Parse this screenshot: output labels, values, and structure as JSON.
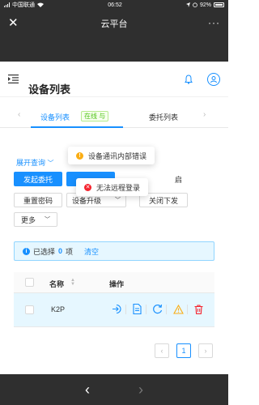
{
  "statusbar": {
    "carrier": "中国联通",
    "time": "06:52",
    "battery": "92%"
  },
  "titlebar": {
    "close_icon": "close-icon",
    "title": "云平台",
    "more": "···"
  },
  "topbar": {
    "menu_icon": "indent-menu-icon",
    "bell_icon": "bell-icon",
    "user_icon": "user-icon",
    "accent": "#1890ff"
  },
  "page": {
    "title": "设备列表"
  },
  "tabs": {
    "items": [
      {
        "label": "设备列表",
        "badge": "在线 与",
        "active": true
      },
      {
        "label": "委托列表",
        "active": false
      }
    ]
  },
  "filters": {
    "expand_label": "展开查询"
  },
  "toolbar": {
    "row1": [
      "发起委托",
      "",
      "启"
    ],
    "row2": [
      "重置密码",
      "设备升级",
      "关闭下发"
    ],
    "more": "更多"
  },
  "selection": {
    "prefix": "已选择",
    "count": "0",
    "suffix": "项",
    "clear": "清空"
  },
  "table": {
    "columns": [
      "名称",
      "操作"
    ],
    "rows": [
      {
        "name": "K2P"
      }
    ],
    "action_icons": [
      "login-icon",
      "file-icon",
      "refresh-icon",
      "warning-icon",
      "delete-icon"
    ]
  },
  "pagination": {
    "prev": "‹",
    "current": "1",
    "next": "›"
  },
  "toasts": [
    {
      "type": "warning",
      "text": "设备通讯内部错误",
      "color": "#faad14"
    },
    {
      "type": "error",
      "text": "无法远程登录",
      "color": "#f5222d"
    }
  ],
  "bottom_nav": {
    "back": "‹",
    "forward": "›"
  }
}
